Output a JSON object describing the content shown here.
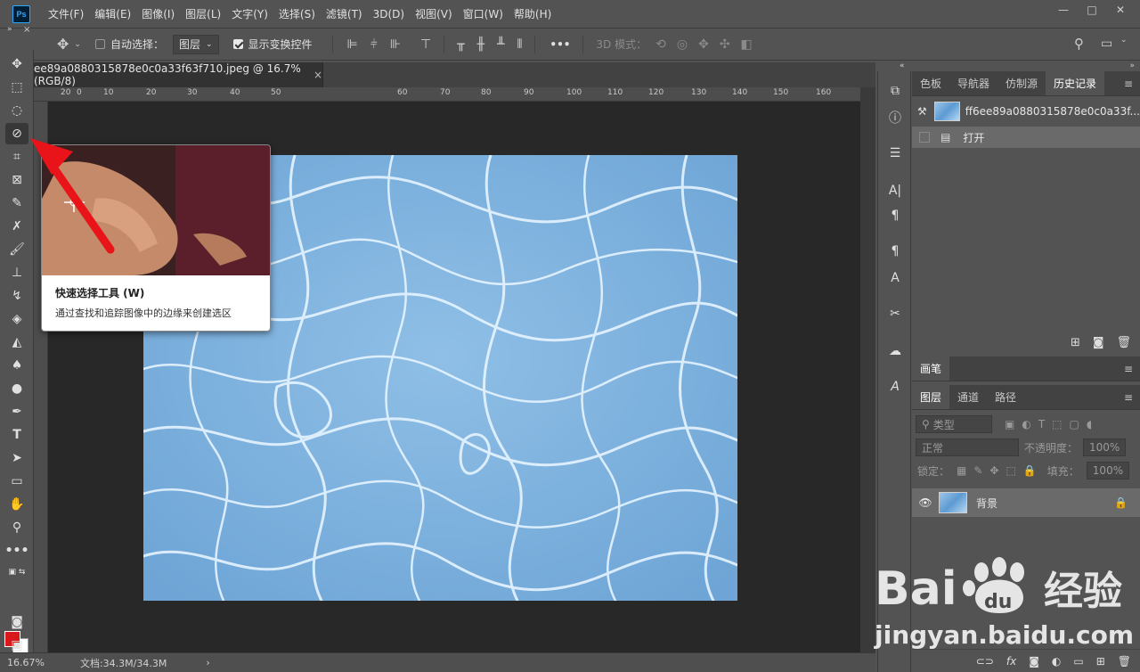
{
  "app": {
    "logo": "Ps",
    "menus": [
      "文件(F)",
      "编辑(E)",
      "图像(I)",
      "图层(L)",
      "文字(Y)",
      "选择(S)",
      "滤镜(T)",
      "3D(D)",
      "视图(V)",
      "窗口(W)",
      "帮助(H)"
    ],
    "window_controls": [
      "—",
      "□",
      "✕"
    ]
  },
  "options_bar": {
    "auto_select_label": "自动选择：",
    "auto_select_checked": false,
    "target_value": "图层",
    "show_transform_label": "显示变换控件",
    "show_transform_checked": true,
    "more_label": "•••",
    "mode_3d_label": "3D 模式："
  },
  "document": {
    "tab_title": "ee89a0880315878e0c0a33f63f710.jpeg @ 16.7%(RGB/8)",
    "close_symbol": "×",
    "ruler_marks": [
      "20",
      "0",
      "10",
      "20",
      "30",
      "40",
      "50",
      "60",
      "70",
      "80",
      "90",
      "100",
      "110",
      "120",
      "130",
      "140",
      "150",
      "160"
    ]
  },
  "tooltip": {
    "title": "快速选择工具 (W)",
    "description": "通过查找和追踪图像中的边缘来创建选区"
  },
  "status": {
    "zoom": "16.67%",
    "doc_info": "文档:34.3M/34.3M",
    "arrow": "›"
  },
  "history_panel": {
    "tabs": [
      "色板",
      "导航器",
      "仿制源",
      "历史记录"
    ],
    "active_tab": "历史记录",
    "snapshot_name": "ff6ee89a0880315878e0c0a33f...",
    "items": [
      "打开"
    ]
  },
  "brush_panel": {
    "title": "画笔"
  },
  "layers_panel": {
    "tabs": [
      "图层",
      "通道",
      "路径"
    ],
    "filter_label": "类型",
    "blend_mode": "正常",
    "opacity_label": "不透明度：",
    "opacity_value": "100%",
    "lock_label": "锁定：",
    "fill_label": "填充：",
    "fill_value": "100%",
    "layers": [
      {
        "name": "背景",
        "visible": true,
        "locked": true
      }
    ],
    "footer_icons": [
      "link-icon",
      "fx-icon",
      "mask-icon",
      "adjustment-icon",
      "folder-icon",
      "new-layer-icon",
      "trash-icon"
    ]
  },
  "colors": {
    "foreground": "#d9181b",
    "background": "#ffffff",
    "arrow": "#e8141a"
  },
  "watermark": {
    "text": "jingyan.baidu.com",
    "brand": "Bai du 经验"
  }
}
